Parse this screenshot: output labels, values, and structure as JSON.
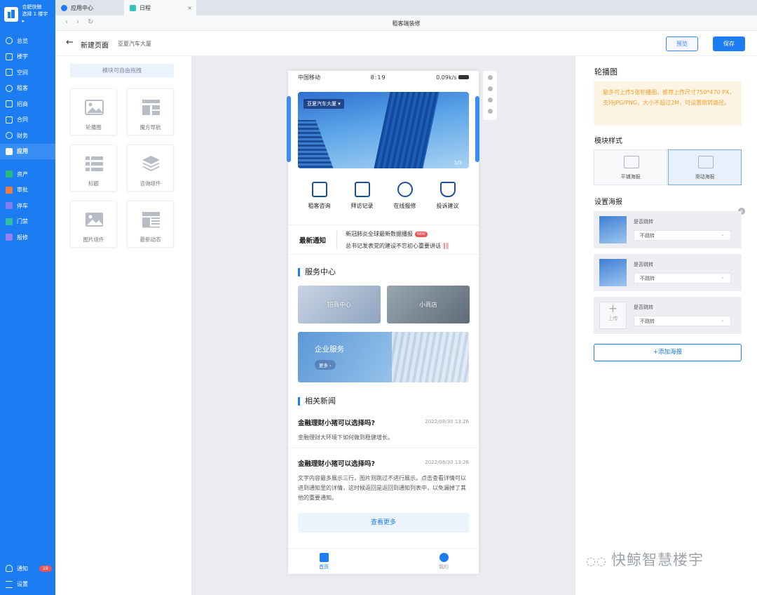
{
  "sidebar": {
    "org_name": "合肥快鲸",
    "org_sub": "选择 1 楼宇",
    "items": [
      {
        "label": "总览"
      },
      {
        "label": "楼宇"
      },
      {
        "label": "空间"
      },
      {
        "label": "租客"
      },
      {
        "label": "招商"
      },
      {
        "label": "合同"
      },
      {
        "label": "财务"
      },
      {
        "label": "应用"
      },
      {
        "label": "资产"
      },
      {
        "label": "审批"
      },
      {
        "label": "停车"
      },
      {
        "label": "门禁"
      },
      {
        "label": "报修"
      }
    ],
    "bottom": {
      "notify_label": "通知",
      "notify_count": "18",
      "settings_label": "设置"
    }
  },
  "tabs": [
    {
      "label": "应用中心"
    },
    {
      "label": "日程"
    }
  ],
  "window_title": "租客端装修",
  "page": {
    "title": "新建页面",
    "subtitle": "亚夏汽车大厦",
    "preview_label": "预览",
    "save_label": "保存"
  },
  "modules": {
    "tip": "模块可自由拖拽",
    "items": [
      {
        "label": "轮播图"
      },
      {
        "label": "魔方导航"
      },
      {
        "label": "标题"
      },
      {
        "label": "咨询组件"
      },
      {
        "label": "图片组件"
      },
      {
        "label": "最新动态"
      }
    ]
  },
  "phone": {
    "carrier": "中国移动",
    "time": "8:19",
    "net": "0.09k/s",
    "banner_location": "亚夏汽车大厦",
    "banner_page": "1/3",
    "quick": [
      {
        "label": "租客咨询"
      },
      {
        "label": "拜访记录"
      },
      {
        "label": "在线报修"
      },
      {
        "label": "投诉建议"
      }
    ],
    "notice": {
      "heading": "最新通知",
      "line1": "新冠肺炎全球最新数据播报",
      "new_tag": "NEW",
      "line2": "总书记发表党的建设不忘初心重要讲话"
    },
    "service_heading": "服务中心",
    "services": [
      {
        "label": "招商中心"
      },
      {
        "label": "小商店"
      }
    ],
    "enterprise": {
      "title": "企业服务",
      "more": "更多 ›"
    },
    "news_heading": "相关新闻",
    "news": [
      {
        "title": "金融理财小猪可以选择吗?",
        "date": "2022/08/30  13:26",
        "body": "金融理财大环境下如何做到稳健增长。"
      },
      {
        "title": "金融理财小猪可以选择吗?",
        "date": "2022/08/30  13:26",
        "body": "文字内容最多展示三行，图片则跳过不进行展示。点击查看详情可以进到通知里的详情，这时候返回是返回到通知列表中，以免漏掉了其他的重要通知。"
      }
    ],
    "view_more": "查看更多",
    "tabbar": [
      {
        "label": "首页"
      },
      {
        "label": "我的"
      }
    ]
  },
  "right": {
    "heading": "轮播图",
    "warning": "最多可上传5张轮播图，推荐上传尺寸750*470 PX，支持JPG/PNG，大小不超过2M，可设置跳转路径。",
    "style_heading": "模块样式",
    "styles": [
      {
        "label": "平铺海报"
      },
      {
        "label": "滑动海报"
      }
    ],
    "poster_heading": "设置海报",
    "posters": [
      {
        "question": "是否跳转",
        "select": "不跳转"
      },
      {
        "question": "是否跳转",
        "select": "不跳转"
      },
      {
        "question": "是否跳转",
        "select": "不跳转",
        "upload_label": "上传"
      }
    ],
    "add_label": "+添加海报"
  },
  "watermark": "快鲸智慧楼宇",
  "colors": {
    "primary": "#1c7cf2",
    "warning_text": "#f59e2c",
    "warning_bg": "#fdf4e3",
    "badge": "#f05454"
  }
}
